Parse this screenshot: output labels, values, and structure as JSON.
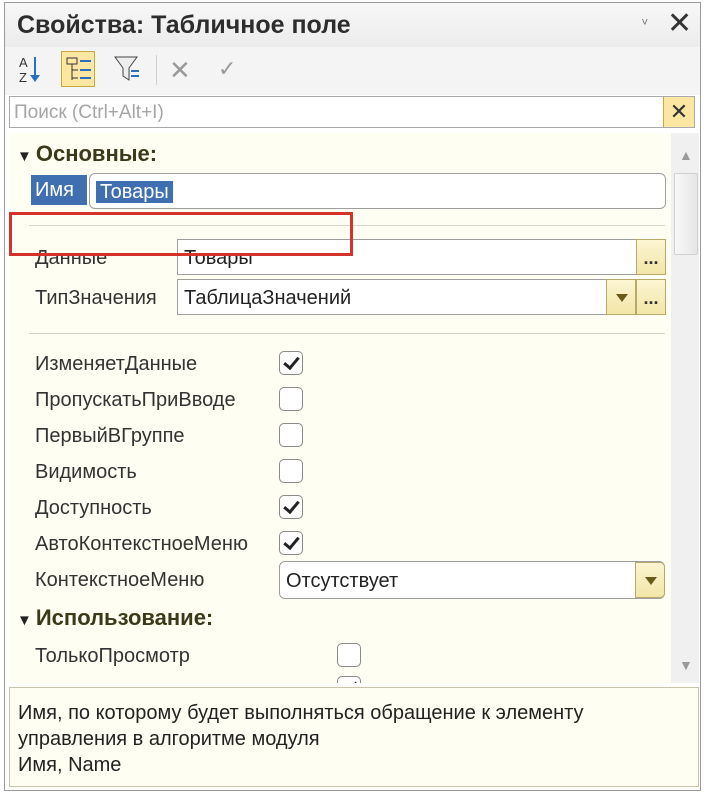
{
  "window": {
    "title": "Свойства: Табличное поле",
    "pin_glyph": "ⱽ",
    "close_glyph": "✕"
  },
  "search": {
    "placeholder": "Поиск (Ctrl+Alt+I)",
    "clear_glyph": "✕"
  },
  "toolbar": {
    "sort_alpha_icon": "sort-alpha-icon",
    "categories_icon": "categories-icon",
    "filter_icon": "filter-icon",
    "cancel_glyph": "✕",
    "confirm_glyph": "✓"
  },
  "sections": {
    "main": "Основные:",
    "usage": "Использование:"
  },
  "properties": {
    "name": {
      "label": "Имя",
      "value": "Товары"
    },
    "data": {
      "label": "Данные",
      "value": "Товары",
      "button": "..."
    },
    "value_type": {
      "label": "ТипЗначения",
      "value": "ТаблицаЗначений",
      "button": "..."
    },
    "changes_data": {
      "label": "ИзменяетДанные",
      "checked": true
    },
    "skip_on_input": {
      "label": "ПропускатьПриВводе",
      "checked": false
    },
    "first_in_group": {
      "label": "ПервыйВГруппе",
      "checked": false
    },
    "visibility": {
      "label": "Видимость",
      "checked": false
    },
    "enabled": {
      "label": "Доступность",
      "checked": true
    },
    "auto_context_menu": {
      "label": "АвтоКонтекстноеМеню",
      "checked": true
    },
    "context_menu": {
      "label": "КонтекстноеМеню",
      "value": "Отсутствует"
    },
    "read_only": {
      "label": "ТолькоПросмотр",
      "checked": false
    }
  },
  "scrollbar": {
    "up_glyph": "▲",
    "down_glyph": "▼"
  },
  "description": {
    "line1": "Имя, по которому будет выполняться обращение к элементу",
    "line2": "управления в алгоритме модуля",
    "line3": "Имя, Name"
  },
  "colors": {
    "accent": "#fbe7a1",
    "selection": "#3f6fb0",
    "highlight": "#d5322b",
    "panel": "#fffef2"
  }
}
